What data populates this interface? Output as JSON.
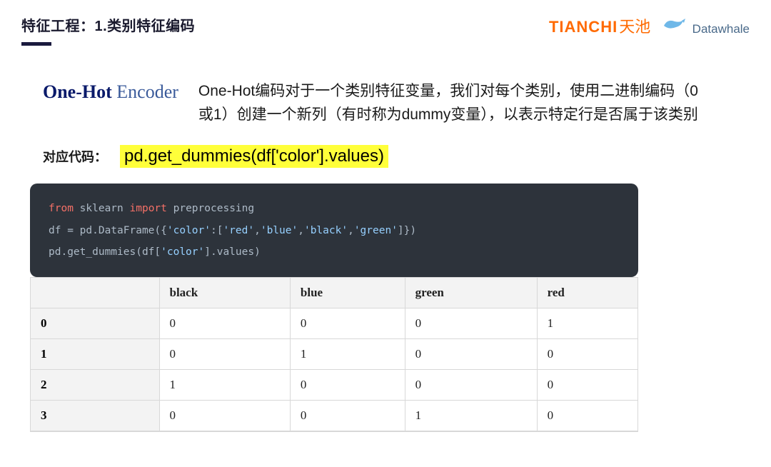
{
  "header": {
    "title": "特征工程：1.类别特征编码",
    "logo_tianchi_en": "TIANCHI",
    "logo_tianchi_cn": "天池",
    "logo_datawhale": "Datawhale"
  },
  "method": {
    "bold": "One-Hot",
    "light": " Encoder"
  },
  "description": "One-Hot编码对于一个类别特征变量，我们对每个类别，使用二进制编码（0或1）创建一个新列（有时称为dummy变量），以表示特定行是否属于该类别",
  "code_section": {
    "label": "对应代码：",
    "highlighted": "pd.get_dummies(df['color'].values)"
  },
  "code_block": {
    "line1_from": "from",
    "line1_mod": " sklearn ",
    "line1_import": "import",
    "line1_rest": " preprocessing",
    "line2_a": "df = pd.DataFrame({",
    "line2_s1": "'color'",
    "line2_b": ":[",
    "line2_s2": "'red'",
    "line2_c": ",",
    "line2_s3": "'blue'",
    "line2_d": ",",
    "line2_s4": "'black'",
    "line2_e": ",",
    "line2_s5": "'green'",
    "line2_f": "]})",
    "line3_a": "pd.get_dummies(df[",
    "line3_s1": "'color'",
    "line3_b": "].values)"
  },
  "chart_data": {
    "type": "table",
    "columns": [
      "black",
      "blue",
      "green",
      "red"
    ],
    "index": [
      "0",
      "1",
      "2",
      "3"
    ],
    "rows": [
      [
        0,
        0,
        0,
        1
      ],
      [
        0,
        1,
        0,
        0
      ],
      [
        1,
        0,
        0,
        0
      ],
      [
        0,
        0,
        1,
        0
      ]
    ]
  }
}
